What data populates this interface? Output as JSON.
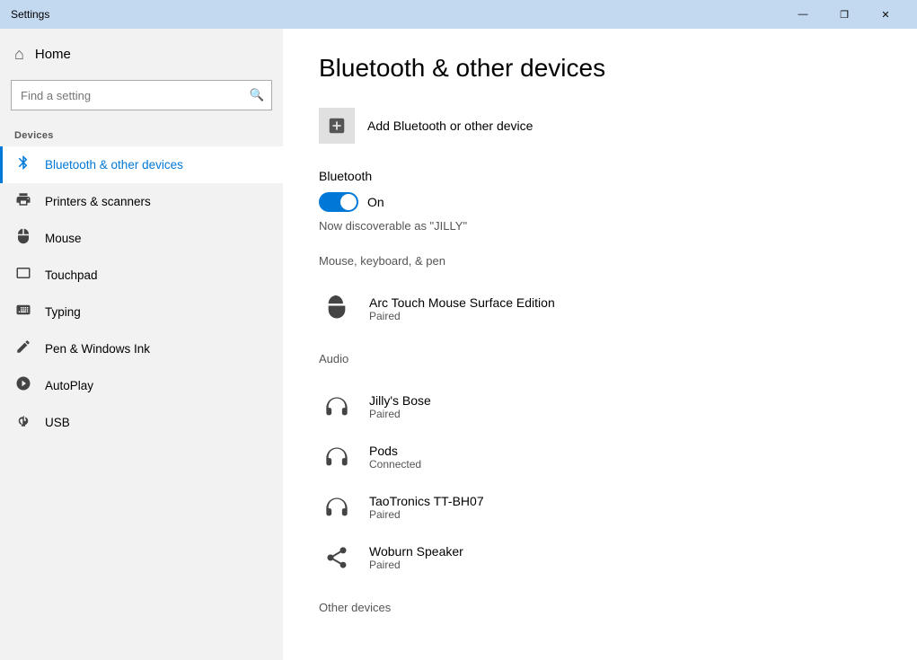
{
  "titlebar": {
    "title": "Settings",
    "minimize": "—",
    "maximize": "❐",
    "close": "✕"
  },
  "sidebar": {
    "home_label": "Home",
    "search_placeholder": "Find a setting",
    "section_label": "Devices",
    "items": [
      {
        "id": "bluetooth",
        "label": "Bluetooth & other devices",
        "icon": "🔷",
        "active": true
      },
      {
        "id": "printers",
        "label": "Printers & scanners",
        "icon": "🖨",
        "active": false
      },
      {
        "id": "mouse",
        "label": "Mouse",
        "icon": "🖱",
        "active": false
      },
      {
        "id": "touchpad",
        "label": "Touchpad",
        "icon": "▭",
        "active": false
      },
      {
        "id": "typing",
        "label": "Typing",
        "icon": "⌨",
        "active": false
      },
      {
        "id": "pen",
        "label": "Pen & Windows Ink",
        "icon": "✒",
        "active": false
      },
      {
        "id": "autoplay",
        "label": "AutoPlay",
        "icon": "▷",
        "active": false
      },
      {
        "id": "usb",
        "label": "USB",
        "icon": "⎇",
        "active": false
      }
    ]
  },
  "content": {
    "page_title": "Bluetooth & other devices",
    "add_device_label": "Add Bluetooth or other device",
    "bluetooth_section_label": "Bluetooth",
    "toggle_state": "On",
    "discoverable_text": "Now discoverable as \"JILLY\"",
    "mouse_section_label": "Mouse, keyboard, & pen",
    "devices_mouse": [
      {
        "name": "Arc Touch Mouse Surface Edition",
        "status": "Paired",
        "icon": "mouse"
      }
    ],
    "audio_section_label": "Audio",
    "devices_audio": [
      {
        "name": "Jilly's Bose",
        "status": "Paired",
        "icon": "headphones"
      },
      {
        "name": "Pods",
        "status": "Connected",
        "icon": "headphones"
      },
      {
        "name": "TaoTronics TT-BH07",
        "status": "Paired",
        "icon": "headphones"
      },
      {
        "name": "Woburn Speaker",
        "status": "Paired",
        "icon": "speaker"
      }
    ],
    "other_section_label": "Other devices"
  }
}
